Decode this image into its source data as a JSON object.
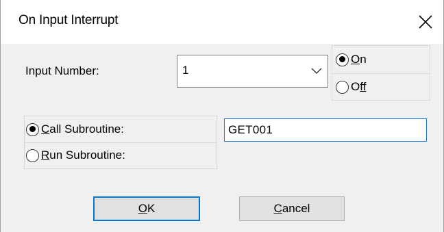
{
  "window": {
    "title": "On Input Interrupt",
    "close_icon": "close-icon"
  },
  "input_number": {
    "label": "Input Number:",
    "selected_value": "1",
    "dropdown_icon": "chevron-down-icon"
  },
  "state_options": {
    "on": {
      "mnemonic": "O",
      "rest": "n",
      "checked": true
    },
    "off": {
      "mnemonic": "O",
      "rest": "ff",
      "label_full": "Off",
      "checked": false
    }
  },
  "subroutine_options": {
    "call": {
      "mnemonic": "C",
      "rest": "all Subroutine:",
      "checked": true
    },
    "run": {
      "mnemonic": "R",
      "rest": "un Subroutine:",
      "checked": false
    }
  },
  "subroutine_name": {
    "value": "GET001"
  },
  "buttons": {
    "ok": {
      "mnemonic": "O",
      "rest": "K"
    },
    "cancel": {
      "mnemonic": "C",
      "rest": "ancel"
    }
  }
}
